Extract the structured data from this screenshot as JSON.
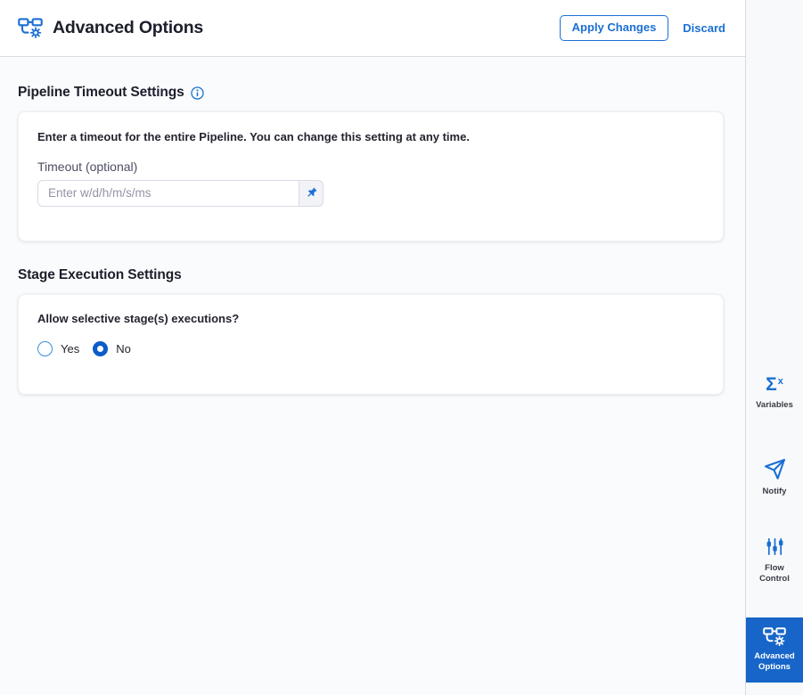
{
  "header": {
    "title": "Advanced Options",
    "apply_label": "Apply Changes",
    "discard_label": "Discard"
  },
  "pipeline_timeout": {
    "heading": "Pipeline Timeout Settings",
    "description": "Enter a timeout for the entire Pipeline. You can change this setting at any time.",
    "timeout_label": "Timeout (optional)",
    "timeout_placeholder": "Enter w/d/h/m/s/ms",
    "timeout_value": ""
  },
  "stage_execution": {
    "heading": "Stage Execution Settings",
    "question": "Allow selective stage(s) executions?",
    "options": [
      {
        "label": "Yes",
        "selected": false
      },
      {
        "label": "No",
        "selected": true
      }
    ]
  },
  "sidebar": {
    "items": [
      {
        "label": "Variables",
        "icon": "sigma-x-icon",
        "selected": false
      },
      {
        "label": "Notify",
        "icon": "paper-plane-icon",
        "selected": false
      },
      {
        "label": "Flow Control",
        "icon": "sliders-icon",
        "selected": false
      },
      {
        "label": "Advanced Options",
        "icon": "pipeline-gear-icon",
        "selected": true
      }
    ]
  },
  "colors": {
    "accent": "#1a6fd4",
    "selected_bg": "#1765c8",
    "radio_selected": "#0b5dc7",
    "header_bg": "#ffffff",
    "main_bg": "#fafbfc",
    "sidebar_bg": "#f8f9fa",
    "border": "#d9dae6",
    "text_dark": "#1d1e2c",
    "text_muted": "#4c4e64",
    "placeholder": "#9394a8"
  }
}
